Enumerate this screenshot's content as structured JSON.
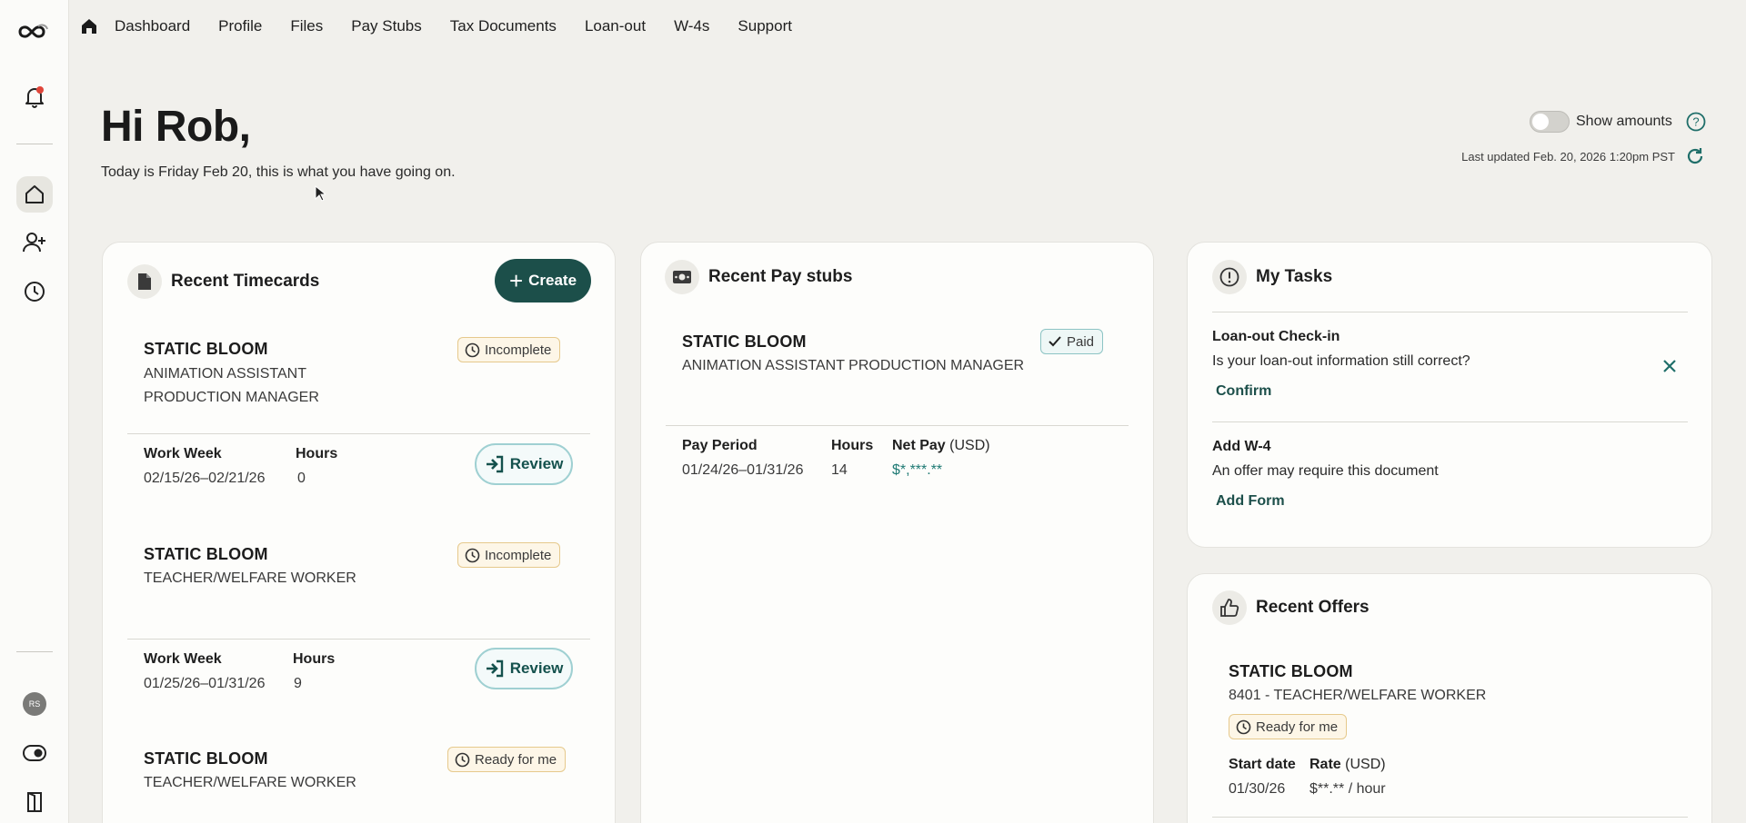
{
  "nav": {
    "items": [
      "Dashboard",
      "Profile",
      "Files",
      "Pay Stubs",
      "Tax Documents",
      "Loan-out",
      "W-4s",
      "Support"
    ]
  },
  "sidebar": {
    "avatar_initials": "RS"
  },
  "header": {
    "greeting": "Hi Rob,",
    "subtitle": "Today is Friday Feb 20, this is what you have going on.",
    "show_amounts_label": "Show amounts",
    "show_amounts_on": false,
    "last_updated": "Last updated Feb. 20, 2026 1:20pm PST"
  },
  "timecards": {
    "title": "Recent Timecards",
    "create_label": "Create",
    "work_week_label": "Work Week",
    "hours_label": "Hours",
    "review_label": "Review",
    "entries": [
      {
        "company": "STATIC BLOOM",
        "role_line1": "ANIMATION ASSISTANT",
        "role_line2": "PRODUCTION MANAGER",
        "status": "Incomplete",
        "work_week": "02/15/26–02/21/26",
        "hours": "0"
      },
      {
        "company": "STATIC BLOOM",
        "role_line1": "TEACHER/WELFARE WORKER",
        "status": "Incomplete",
        "work_week": "01/25/26–01/31/26",
        "hours": "9"
      },
      {
        "company": "STATIC BLOOM",
        "role_line1": "TEACHER/WELFARE WORKER",
        "status": "Ready for me"
      }
    ]
  },
  "paystubs": {
    "title": "Recent Pay stubs",
    "entry": {
      "company": "STATIC BLOOM",
      "role": "ANIMATION ASSISTANT PRODUCTION MANAGER",
      "status": "Paid",
      "pay_period_label": "Pay Period",
      "hours_label": "Hours",
      "net_pay_label": "Net Pay",
      "net_pay_unit": "(USD)",
      "pay_period": "01/24/26–01/31/26",
      "hours": "14",
      "net_pay": "$*,***.**"
    }
  },
  "tasks": {
    "title": "My Tasks",
    "items": [
      {
        "title": "Loan-out Check-in",
        "desc": "Is your loan-out information still correct?",
        "action": "Confirm"
      },
      {
        "title": "Add W-4",
        "desc": "An offer may require this document",
        "action": "Add Form"
      }
    ]
  },
  "offers": {
    "title": "Recent Offers",
    "entry": {
      "company": "STATIC BLOOM",
      "role": "8401 - TEACHER/WELFARE WORKER",
      "status": "Ready for me",
      "start_date_label": "Start date",
      "rate_label": "Rate",
      "rate_unit": "(USD)",
      "start_date": "01/30/26",
      "rate": "$**.** / hour"
    }
  }
}
